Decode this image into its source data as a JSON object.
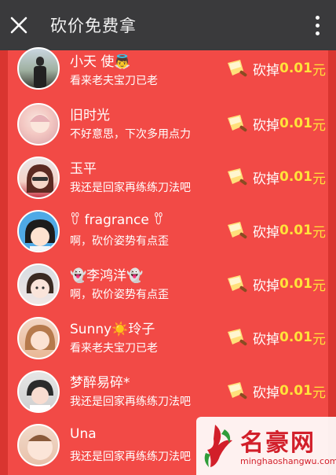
{
  "header": {
    "title": "砍价免费拿"
  },
  "cut_label": "砍掉",
  "rows": [
    {
      "name": "小天 使👼",
      "message": "看来老夫宝刀已老",
      "amount": "0.01",
      "unit": "元"
    },
    {
      "name": "旧时光",
      "message": "不好意思，下次多用点力",
      "amount": "0.01",
      "unit": "元"
    },
    {
      "name": "玉平",
      "message": "我还是回家再练练刀法吧",
      "amount": "0.01",
      "unit": "元"
    },
    {
      "name": "ꀎ fragrance ꀎ",
      "message": "啊，砍价姿势有点歪",
      "amount": "0.01",
      "unit": "元"
    },
    {
      "name": "👻李鸿洋👻",
      "message": "啊，砍价姿势有点歪",
      "amount": "0.01",
      "unit": "元"
    },
    {
      "name": "Sunny☀️玲子",
      "message": "看来老夫宝刀已老",
      "amount": "0.01",
      "unit": "元"
    },
    {
      "name": "梦醉易碎*",
      "message": "我还是回家再练练刀法吧",
      "amount": "0.01",
      "unit": "元"
    },
    {
      "name": "Una",
      "message": "我还是回家再练练刀法吧",
      "amount": "",
      "unit": ""
    }
  ],
  "icons": {
    "close": "close-icon",
    "more": "more-vertical-icon",
    "cut": "cleaver-icon"
  },
  "colors": {
    "header_bg": "#3a3a3c",
    "panel_bg": "#f24a46",
    "page_bg": "#d93530",
    "amount": "#ffe23a"
  },
  "watermark": {
    "title": "名豪网",
    "url": "minghaoshangwu.com"
  }
}
